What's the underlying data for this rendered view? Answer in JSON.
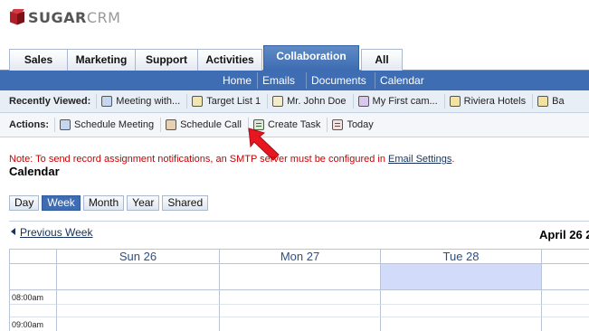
{
  "app": {
    "logo_text_main": "SUGAR",
    "logo_text_accent": "CRM"
  },
  "tabs": [
    {
      "label": "Sales",
      "active": false
    },
    {
      "label": "Marketing",
      "active": false
    },
    {
      "label": "Support",
      "active": false
    },
    {
      "label": "Activities",
      "active": false
    },
    {
      "label": "Collaboration",
      "active": true
    },
    {
      "label": "All",
      "active": false
    }
  ],
  "subnav": [
    "Home",
    "Emails",
    "Documents",
    "Calendar"
  ],
  "recently_viewed": {
    "label": "Recently Viewed:",
    "items": [
      {
        "label": "Meeting with...",
        "icon": "meeting-icon"
      },
      {
        "label": "Target List 1",
        "icon": "target-list-icon"
      },
      {
        "label": "Mr. John Doe",
        "icon": "contact-icon"
      },
      {
        "label": "My First cam...",
        "icon": "campaign-icon"
      },
      {
        "label": "Riviera Hotels",
        "icon": "account-folder-icon"
      },
      {
        "label": "Ba",
        "icon": "account-folder-icon"
      }
    ]
  },
  "actions": {
    "label": "Actions:",
    "items": [
      {
        "label": "Schedule Meeting",
        "icon": "meeting-icon"
      },
      {
        "label": "Schedule Call",
        "icon": "call-icon"
      },
      {
        "label": "Create Task",
        "icon": "task-icon"
      },
      {
        "label": "Today",
        "icon": "today-icon"
      }
    ]
  },
  "notice": {
    "text": "Note: To send record assignment notifications, an SMTP server must be configured in ",
    "link": "Email Settings",
    "suffix": "."
  },
  "calendar": {
    "title": "Calendar",
    "views": [
      {
        "label": "Day",
        "active": false
      },
      {
        "label": "Week",
        "active": true
      },
      {
        "label": "Month",
        "active": false
      },
      {
        "label": "Year",
        "active": false
      },
      {
        "label": "Shared",
        "active": false
      }
    ],
    "previous_link": "Previous Week",
    "current_range": "April 26 2",
    "day_headers": [
      "Sun 26",
      "Mon 27",
      "Tue 28"
    ],
    "time_slots": [
      "08:00am",
      "09:00am"
    ]
  },
  "colors": {
    "accent": "#3f6db3",
    "today_highlight": "#d2dcfa",
    "notice": "#cc0000",
    "pointer_arrow": "#e8161f"
  }
}
